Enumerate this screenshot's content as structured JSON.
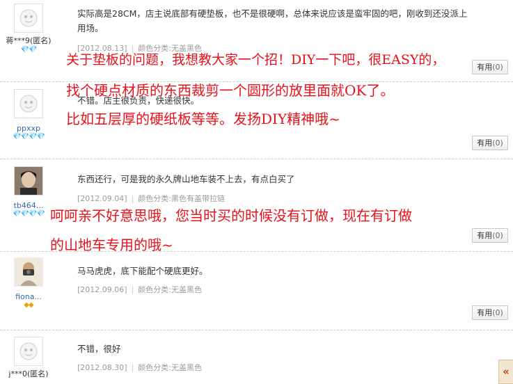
{
  "reviews": [
    {
      "user": "蒋***9(匿名)",
      "rank": "💎💎",
      "text": "实际高是28CM，店主说底部有硬垫板，也不是很硬啊，总体来说应该是蛮牢固的吧，刚收到还没派上用场。",
      "date": "[2012.08.13]",
      "attr": "颜色分类:无盖黑色",
      "useful_label": "有用",
      "useful_count": "(0)"
    },
    {
      "user": "ppxxp",
      "rank": "💎💎💎💎",
      "text": "不错。店主很负责，快递很快。",
      "useful_label": "有用",
      "useful_count": "(0)"
    },
    {
      "user": "tb464...",
      "rank": "💎💎💎💎",
      "text": "东西还行，可是我的永久牌山地车装不上去，有点白买了",
      "date": "[2012.09.04]",
      "attr": "颜色分类:黑色有盖带拉链",
      "useful_label": "有用",
      "useful_count": "(0)"
    },
    {
      "user": "fiona...",
      "rank": "◆◆",
      "text": "马马虎虎，底下能配个硬底更好。",
      "date": "[2012.09.06]",
      "attr": "颜色分类:无盖黑色",
      "useful_label": "有用",
      "useful_count": "(0)"
    },
    {
      "user": "j***0(匿名)",
      "text": "不错，很好",
      "date": "[2012.08.30]",
      "attr": "颜色分类:无盖黑色"
    }
  ],
  "annotations": {
    "line1": "关于垫板的问题，我想教大家一个招！DIY一下吧，很EASY的，",
    "line2": "找个硬点材质的东西裁剪一个圆形的放里面就OK了。",
    "line3": "比如五层厚的硬纸板等等。发扬DIY精神哦~",
    "line4": "呵呵亲不好意思哦，您当时买的时候没有订做，现在有订做",
    "line5": "的山地车专用的哦~"
  },
  "scroll_tab": "«"
}
